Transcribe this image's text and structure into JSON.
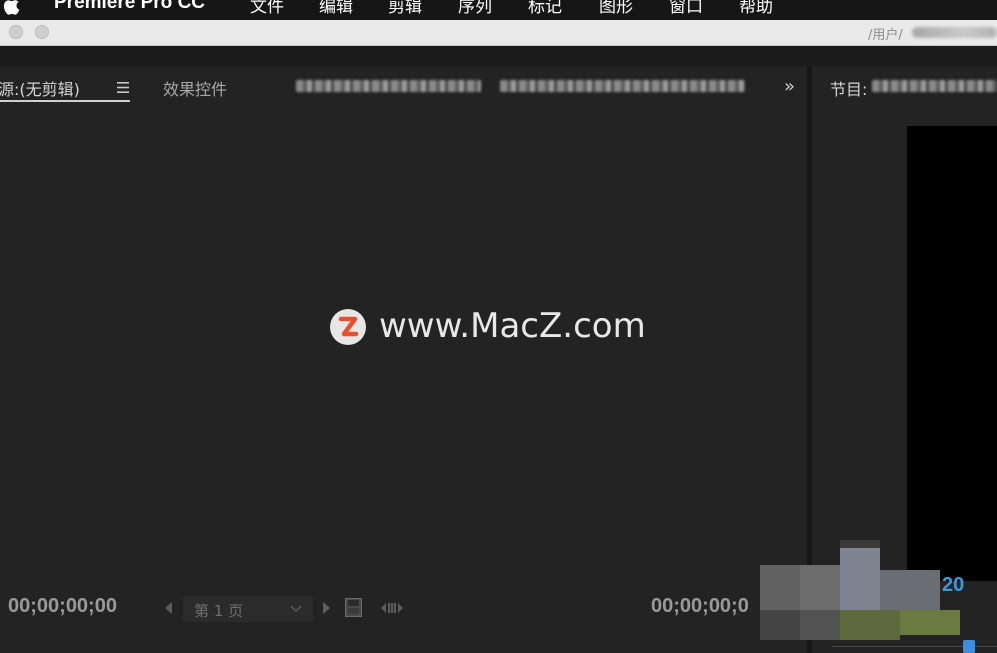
{
  "menubar": {
    "app_name": "Premiere Pro CC",
    "items": [
      "文件",
      "编辑",
      "剪辑",
      "序列",
      "标记",
      "图形",
      "窗口",
      "帮助"
    ]
  },
  "titlebar": {
    "path_prefix": "/用户/"
  },
  "source_panel": {
    "tab_source": "源:(无剪辑)",
    "tab_effects": "效果控件",
    "timecode_in": "00;00;00;00",
    "timecode_out": "00;00;00;0",
    "page_select_value": "第 1 页"
  },
  "program_panel": {
    "tab_label": "节目:",
    "timecode_partial": "20"
  },
  "watermark": {
    "logo_letter": "Z",
    "text": "www.MacZ.com"
  },
  "colors": {
    "background": "#232323",
    "accent_blue": "#3a9bdc",
    "watermark_red": "#e8502d"
  }
}
